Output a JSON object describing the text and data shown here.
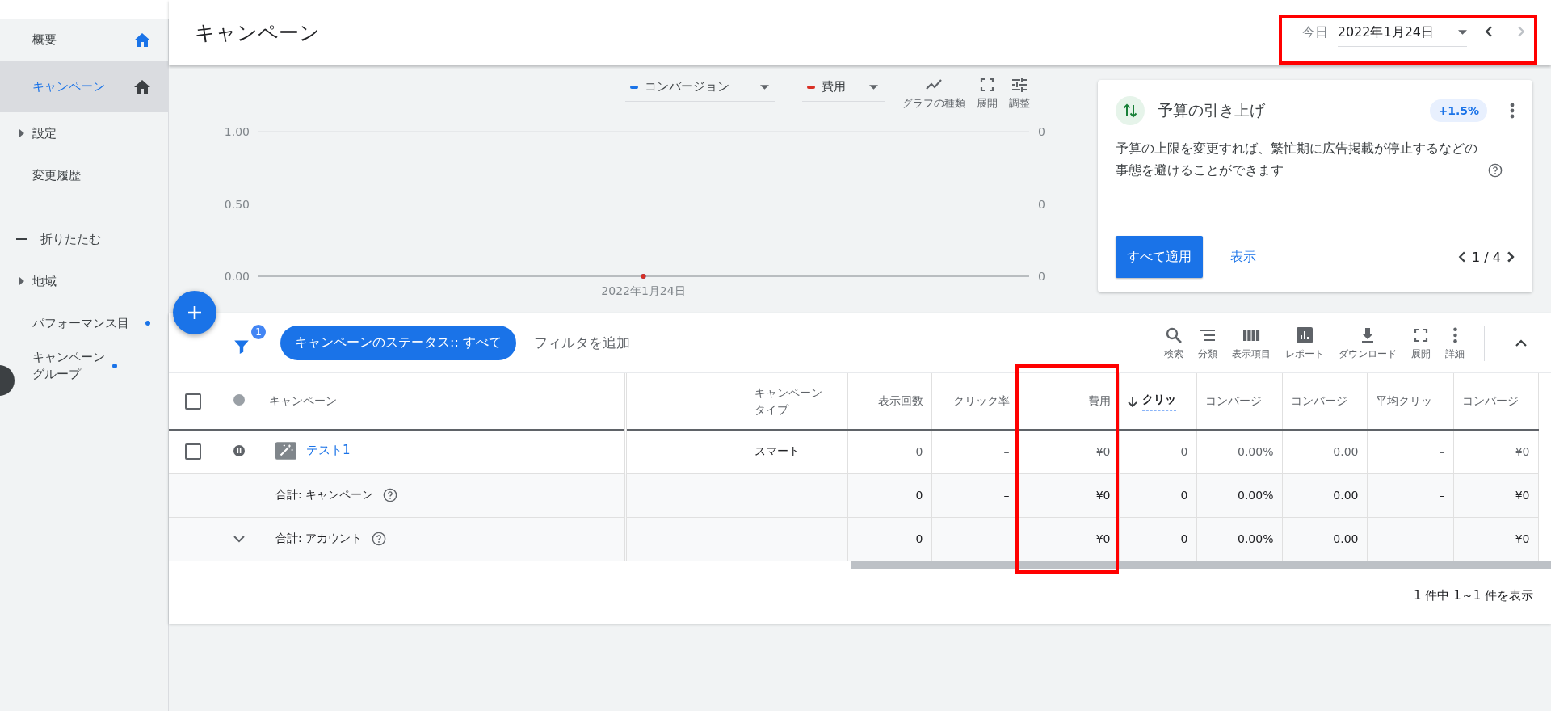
{
  "sidebar": {
    "top_items": [
      {
        "label": "概要",
        "kind": "pinned",
        "selected": false
      },
      {
        "label": "キャンペーン",
        "kind": "pinned",
        "selected": true
      },
      {
        "label": "設定",
        "kind": "expandable",
        "selected": false
      },
      {
        "label": "変更履歴",
        "kind": "plain",
        "selected": false
      }
    ],
    "collapse_label": "折りたたむ",
    "items": [
      {
        "label": "地域",
        "kind": "expandable",
        "selected": false
      },
      {
        "label": "パフォーマンス目",
        "kind": "new",
        "selected": false
      },
      {
        "label": "キャンペーングループ",
        "kind": "new",
        "selected": false
      }
    ]
  },
  "header": {
    "title": "キャンペーン",
    "date_picker": {
      "label": "今日",
      "value": "2022年1月24日",
      "prev_disabled": false,
      "next_disabled": true
    }
  },
  "chart": {
    "tools": [
      {
        "label": "グラフの種類",
        "kind": "chart_type"
      },
      {
        "label": "展開",
        "kind": "expand"
      },
      {
        "label": "調整",
        "kind": "adjust"
      }
    ],
    "right_axis_labels": [
      "0",
      "0",
      "0"
    ],
    "chart_data": {
      "type": "line",
      "x": [
        "2022年1月24日"
      ],
      "series": [
        {
          "name": "コンバージョン",
          "color": "#1a73e8",
          "marker": true,
          "values": [
            0
          ]
        },
        {
          "name": "費用",
          "color": "#d93025",
          "marker": true,
          "values": [
            0
          ]
        }
      ],
      "ylim": [
        0,
        1
      ],
      "yticks": [
        {
          "value": 1,
          "label": "1.00"
        },
        {
          "value": 0.5,
          "label": "0.50"
        },
        {
          "value": 0,
          "label": "0.00"
        }
      ]
    }
  },
  "recommendation": {
    "title": "予算の引き上げ",
    "badge": "+1.5%",
    "text": "予算の上限を変更すれば、繁忙期に広告掲載が停止するなどの事態を避けることができます",
    "apply": "すべて適用",
    "view": "表示",
    "pager": "1 / 4"
  },
  "filters": {
    "count": "1",
    "chip": "キャンペーンのステータス:: すべて",
    "add": "フィルタを追加"
  },
  "table_tools": [
    {
      "label": "検索",
      "kind": "search"
    },
    {
      "label": "分類",
      "kind": "segment"
    },
    {
      "label": "表示項目",
      "kind": "columns"
    },
    {
      "label": "レポート",
      "kind": "report"
    },
    {
      "label": "ダウンロード",
      "kind": "download"
    },
    {
      "label": "展開",
      "kind": "expand"
    },
    {
      "label": "詳細",
      "kind": "more"
    }
  ],
  "table": {
    "columns": [
      {
        "kind": "select",
        "checked": false
      },
      {
        "kind": "status"
      },
      {
        "kind": "text",
        "label": "キャンペーン"
      },
      {
        "kind": "spacer"
      },
      {
        "kind": "text",
        "label": "キャンペーンタイプ"
      },
      {
        "kind": "metric",
        "label": "表示回数"
      },
      {
        "kind": "metric",
        "label": "クリック率"
      },
      {
        "kind": "metric",
        "label": "費用"
      },
      {
        "kind": "sorted",
        "label": "クリッ"
      },
      {
        "kind": "dashed",
        "label": "コンバージ"
      },
      {
        "kind": "dashed",
        "label": "コンバージ"
      },
      {
        "kind": "dashed",
        "label": "平均クリッ"
      },
      {
        "kind": "dashed",
        "label": "コンバージ"
      }
    ],
    "rows": [
      {
        "kind": "campaign",
        "checked": false,
        "name": "テスト1",
        "type": "スマート",
        "values": [
          "0",
          "–",
          "¥0",
          "0",
          "0.00%",
          "0.00",
          "–",
          "¥0"
        ]
      },
      {
        "kind": "campaign_total",
        "name": "合計: キャンペーン",
        "values": [
          "0",
          "–",
          "¥0",
          "0",
          "0.00%",
          "0.00",
          "–",
          "¥0"
        ]
      },
      {
        "kind": "account_total",
        "name": "合計: アカウント",
        "values": [
          "0",
          "–",
          "¥0",
          "0",
          "0.00%",
          "0.00",
          "–",
          "¥0"
        ]
      }
    ],
    "pagination": "1 件中 1～1 件を表示"
  }
}
